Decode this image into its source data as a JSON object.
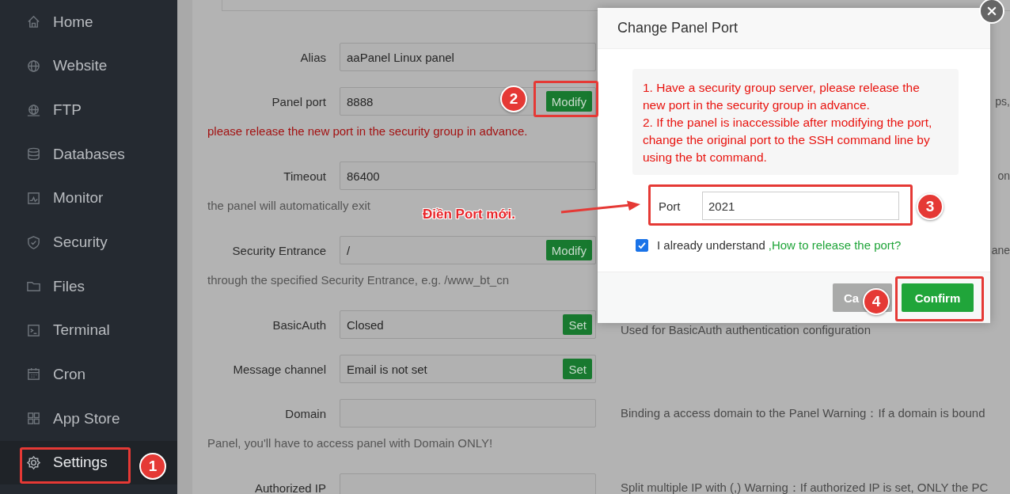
{
  "sidebar": {
    "items": [
      {
        "label": "Home",
        "selected": false
      },
      {
        "label": "Website",
        "selected": false
      },
      {
        "label": "FTP",
        "selected": false
      },
      {
        "label": "Databases",
        "selected": false
      },
      {
        "label": "Monitor",
        "selected": false
      },
      {
        "label": "Security",
        "selected": false
      },
      {
        "label": "Files",
        "selected": false
      },
      {
        "label": "Terminal",
        "selected": false
      },
      {
        "label": "Cron",
        "selected": false
      },
      {
        "label": "App Store",
        "selected": false
      },
      {
        "label": "Settings",
        "selected": true
      }
    ]
  },
  "settings": {
    "rows": [
      {
        "label": "Alias",
        "value": "aaPanel Linux panel"
      },
      {
        "label": "Panel port",
        "value": "8888",
        "button": "Modify",
        "hint_tail": "ps,",
        "note": {
          "text": "please release the new port in the security group in advance.",
          "kind": "warning"
        }
      },
      {
        "label": "Timeout",
        "value": "86400",
        "hint_tail": "on",
        "note": {
          "text": "the panel will automatically exit",
          "kind": "plain"
        }
      },
      {
        "label": "Security Entrance",
        "value": "/",
        "button": "Modify",
        "hint_tail": "ane",
        "note": {
          "text": "through the specified Security Entrance, e.g. /www_bt_cn",
          "kind": "plain"
        }
      },
      {
        "label": "BasicAuth",
        "value": "Closed",
        "button": "Set",
        "hint": "Used for BasicAuth authentication configuration"
      },
      {
        "label": "Message channel",
        "value": "Email is not set",
        "button": "Set"
      },
      {
        "label": "Domain",
        "value": "",
        "hint": "Binding a access domain to the Panel Warning：If a domain is bound",
        "note": {
          "text": "Panel, you'll have to access panel with Domain ONLY!",
          "kind": "plain"
        }
      },
      {
        "label": "Authorized IP",
        "value": "",
        "hint": "Split multiple IP with (,) Warning：If authorized IP is set, ONLY the PC"
      }
    ]
  },
  "dialog": {
    "title": "Change Panel Port",
    "notice": [
      "1. Have a security group server, please release the new port in the security group in advance.",
      "2. If the panel is inaccessible after modifying the port, change the original port to the SSH command line by using the bt command."
    ],
    "port": {
      "label": "Port",
      "value": "2021"
    },
    "agree": {
      "checked": true,
      "label": "I already understand",
      "link": ",How to release the port?"
    },
    "buttons": [
      {
        "label": "Ca",
        "kind": "cancel"
      },
      {
        "label": "Confirm",
        "kind": "primary"
      }
    ]
  },
  "annotations": {
    "badges": [
      "1",
      "2",
      "3",
      "4"
    ],
    "callout": "Điền Port mới."
  }
}
